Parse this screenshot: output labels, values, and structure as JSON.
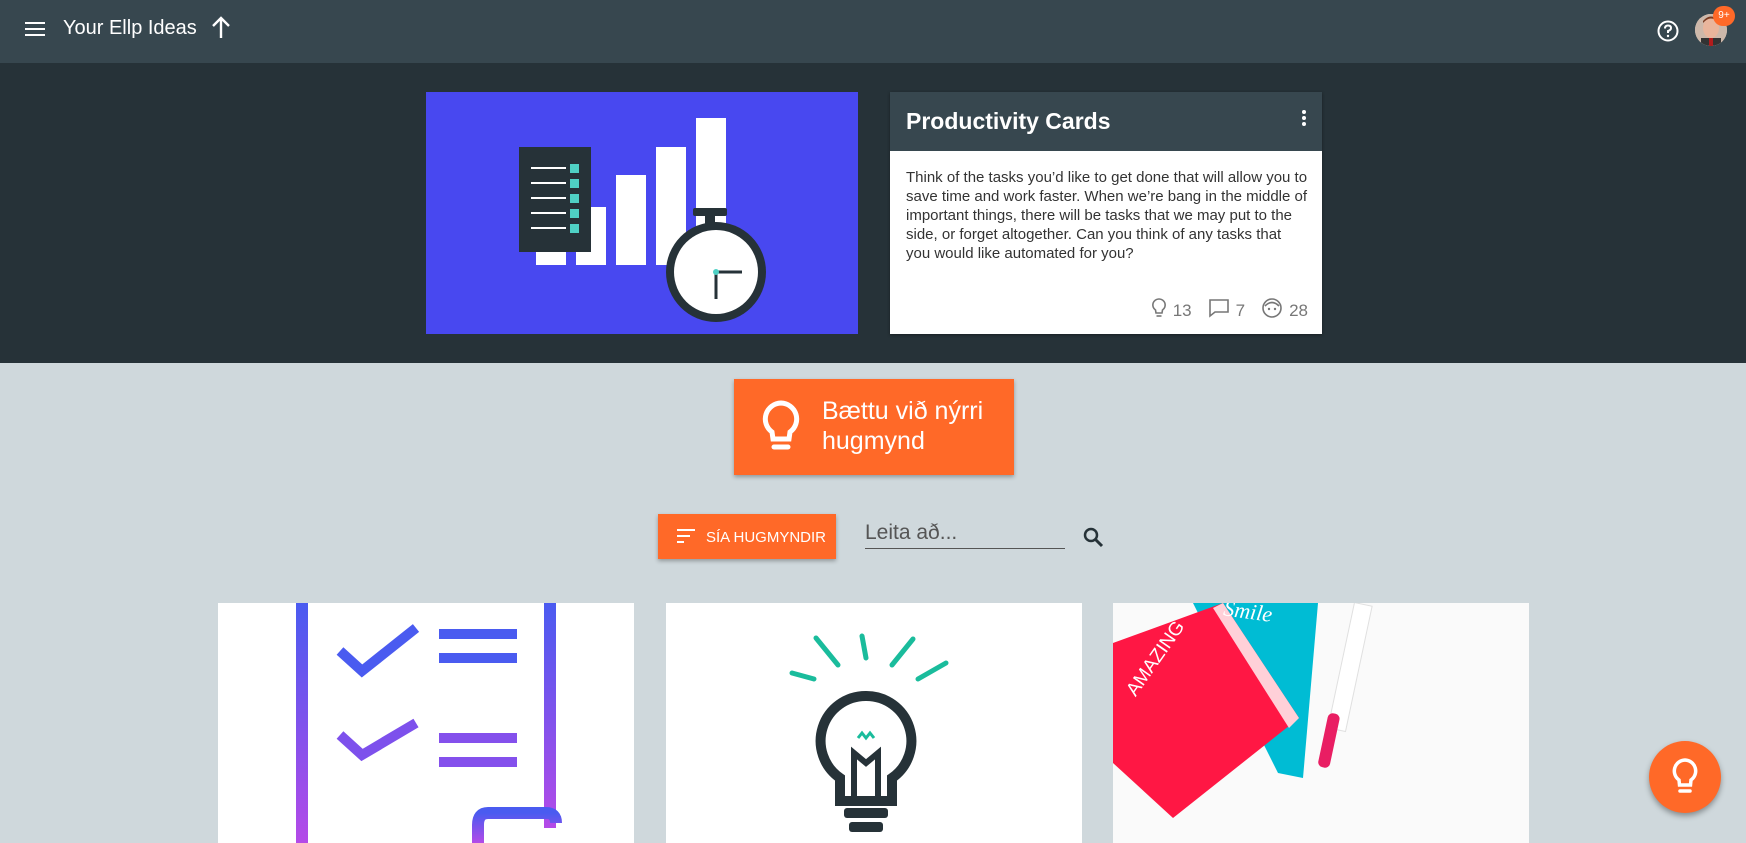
{
  "topbar": {
    "title": "Your Ellp Ideas",
    "notification_count": "9+"
  },
  "featured": {
    "title": "Productivity Cards",
    "description": "Think of the tasks you’d like to get done that will allow you to save time and work faster. When we’re bang in the middle of important things, there will be tasks that we may put to the side, or forget altogether. Can you think of any tasks that you would like automated for you?",
    "ideas_count": "13",
    "comments_count": "7",
    "participants_count": "28"
  },
  "add_idea": {
    "label": "Bættu við nýrri hugmynd"
  },
  "filters": {
    "filter_label": "SÍA HUGMYNDIR",
    "search_placeholder": "Leita að..."
  },
  "idea_cards": [
    {
      "image": "checklist-illustration"
    },
    {
      "image": "lightbulb-illustration"
    },
    {
      "image": "notebooks-photo",
      "image_text": [
        "AMAZING",
        "Smile"
      ]
    }
  ],
  "colors": {
    "topbar": "#37474f",
    "hero": "#263238",
    "page": "#cfd8dc",
    "accent": "#ff6928",
    "hero_image": "#4848f0"
  }
}
